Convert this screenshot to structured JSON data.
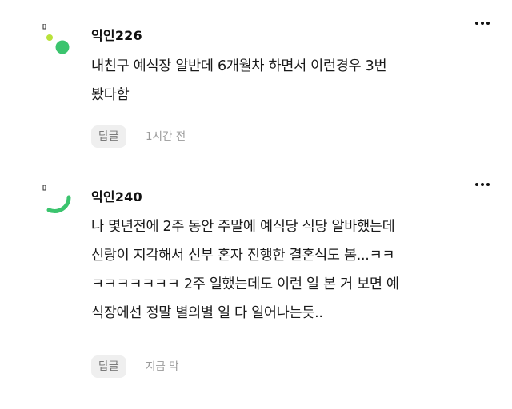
{
  "comments": [
    {
      "username": "익인226",
      "lines": [
        "내친구 예식장 알반데 6개월차 하면서 이런경우 3번",
        "봤다함"
      ],
      "reply_label": "답글",
      "time": "1시간 전",
      "avatar_color": "#3bc46e"
    },
    {
      "username": "익인240",
      "lines": [
        "나 몇년전에 2주 동안 주말에 예식당 식당 알바했는데",
        "신랑이 지각해서 신부 혼자 진행한 결혼식도 봄...ㅋㅋ",
        "ㅋㅋㅋㅋㅋㅋㅋ 2주 일했는데도 이런 일 본 거 보면 예",
        "식장에선 정말 별의별 일 다 일어나는듯.."
      ],
      "reply_label": "답글",
      "time": "지금 막",
      "avatar_color": "#3bc46e"
    }
  ],
  "icons": {
    "more": "more-options-icon",
    "avatar": "avatar-icon"
  }
}
